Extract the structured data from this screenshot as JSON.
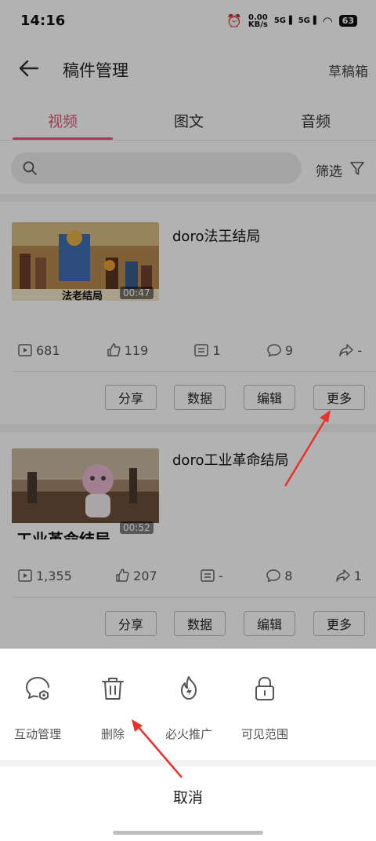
{
  "status": {
    "time": "14:16",
    "net_speed_value": "0.00",
    "net_speed_unit": "KB/s",
    "signal1": "5G",
    "signal2": "5G",
    "battery": "63"
  },
  "header": {
    "title": "稿件管理",
    "drafts": "草稿箱"
  },
  "tabs": [
    {
      "label": "视频",
      "active": true
    },
    {
      "label": "图文",
      "active": false
    },
    {
      "label": "音频",
      "active": false
    }
  ],
  "search": {
    "placeholder": "",
    "filter_label": "筛选"
  },
  "videos": [
    {
      "title": "doro法王结局",
      "thumb_caption": "法老结局",
      "duration": "00:47",
      "stats": {
        "plays": "681",
        "likes": "119",
        "danmaku": "1",
        "comments": "9",
        "shares": "-"
      }
    },
    {
      "title": "doro工业革命结局",
      "thumb_caption": "工业革命结局",
      "duration": "00:52",
      "stats": {
        "plays": "1,355",
        "likes": "207",
        "danmaku": "-",
        "comments": "8",
        "shares": "1"
      }
    }
  ],
  "card_actions": {
    "share": "分享",
    "data": "数据",
    "edit": "编辑",
    "more": "更多"
  },
  "sheet": {
    "items": [
      {
        "label": "互动管理",
        "icon": "interaction-settings-icon"
      },
      {
        "label": "删除",
        "icon": "trash-icon"
      },
      {
        "label": "必火推广",
        "icon": "fire-icon"
      },
      {
        "label": "可见范围",
        "icon": "lock-icon"
      }
    ],
    "cancel": "取消"
  },
  "colors": {
    "accent": "#e0567a",
    "annotation_arrow": "#e8322c"
  }
}
